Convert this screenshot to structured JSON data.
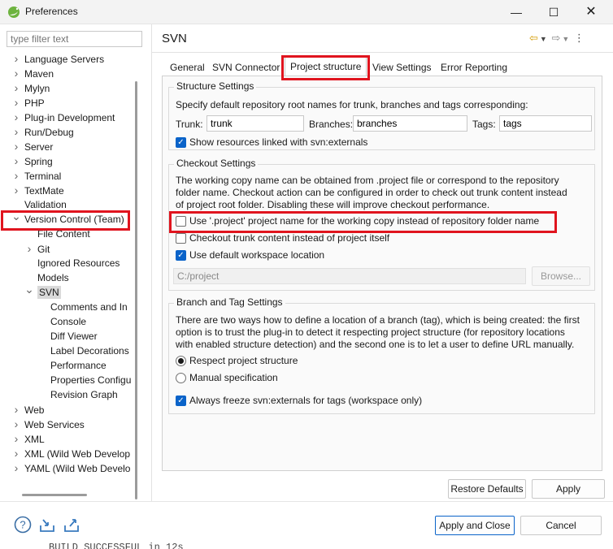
{
  "window": {
    "title": "Preferences",
    "minimize_icon": "minimize-icon",
    "maximize_icon": "maximize-icon",
    "close_icon": "close-icon"
  },
  "sidebar": {
    "filter_placeholder": "type filter text",
    "tree": [
      {
        "label": "Language Servers",
        "level": 0,
        "twisty": "collapsed"
      },
      {
        "label": "Maven",
        "level": 0,
        "twisty": "collapsed"
      },
      {
        "label": "Mylyn",
        "level": 0,
        "twisty": "collapsed"
      },
      {
        "label": "PHP",
        "level": 0,
        "twisty": "collapsed"
      },
      {
        "label": "Plug-in Development",
        "level": 0,
        "twisty": "collapsed"
      },
      {
        "label": "Run/Debug",
        "level": 0,
        "twisty": "collapsed"
      },
      {
        "label": "Server",
        "level": 0,
        "twisty": "collapsed"
      },
      {
        "label": "Spring",
        "level": 0,
        "twisty": "collapsed"
      },
      {
        "label": "Terminal",
        "level": 0,
        "twisty": "collapsed"
      },
      {
        "label": "TextMate",
        "level": 0,
        "twisty": "collapsed"
      },
      {
        "label": "Validation",
        "level": 0,
        "twisty": "none"
      },
      {
        "label": "Version Control (Team)",
        "level": 0,
        "twisty": "expanded"
      },
      {
        "label": "File Content",
        "level": 1,
        "twisty": "none"
      },
      {
        "label": "Git",
        "level": 1,
        "twisty": "collapsed"
      },
      {
        "label": "Ignored Resources",
        "level": 1,
        "twisty": "none"
      },
      {
        "label": "Models",
        "level": 1,
        "twisty": "none"
      },
      {
        "label": "SVN",
        "level": 1,
        "twisty": "expanded",
        "selected": true
      },
      {
        "label": "Comments and In",
        "level": 2,
        "twisty": "none"
      },
      {
        "label": "Console",
        "level": 2,
        "twisty": "none"
      },
      {
        "label": "Diff Viewer",
        "level": 2,
        "twisty": "none"
      },
      {
        "label": "Label Decorations",
        "level": 2,
        "twisty": "none"
      },
      {
        "label": "Performance",
        "level": 2,
        "twisty": "none"
      },
      {
        "label": "Properties Configu",
        "level": 2,
        "twisty": "none"
      },
      {
        "label": "Revision Graph",
        "level": 2,
        "twisty": "none"
      },
      {
        "label": "Web",
        "level": 0,
        "twisty": "collapsed"
      },
      {
        "label": "Web Services",
        "level": 0,
        "twisty": "collapsed"
      },
      {
        "label": "XML",
        "level": 0,
        "twisty": "collapsed"
      },
      {
        "label": "XML (Wild Web Develop",
        "level": 0,
        "twisty": "collapsed"
      },
      {
        "label": "YAML (Wild Web Develo",
        "level": 0,
        "twisty": "collapsed"
      }
    ]
  },
  "panel": {
    "title": "SVN",
    "nav_icons": [
      "back-arrow-icon",
      "dropdown-icon",
      "forward-arrow-icon",
      "dropdown-icon",
      "more-icon"
    ],
    "tabs": [
      "General",
      "SVN Connector",
      "Project structure",
      "View Settings",
      "Error Reporting"
    ],
    "active_tab": "Project structure",
    "structure": {
      "title": "Structure Settings",
      "desc": "Specify default repository root names for trunk, branches and tags corresponding:",
      "trunk_label": "Trunk:",
      "trunk_value": "trunk",
      "branches_label": "Branches:",
      "branches_value": "branches",
      "tags_label": "Tags:",
      "tags_value": "tags",
      "externals_label": "Show resources linked with svn:externals",
      "externals_checked": true
    },
    "checkout": {
      "title": "Checkout Settings",
      "desc": [
        "The working copy name can be obtained from .project file or correspond to the repository",
        "folder name. Checkout action can be configured in order to check out trunk content instead",
        "of project root folder. Disabling these will improve checkout performance."
      ],
      "use_project_label": "Use '.project' project name for the working copy instead of repository folder name",
      "use_project_checked": false,
      "trunk_content_label": "Checkout trunk content instead of project itself",
      "trunk_content_checked": false,
      "default_ws_label": "Use default workspace location",
      "default_ws_checked": true,
      "location_value": "C:/project",
      "browse_label": "Browse..."
    },
    "branch_tag": {
      "title": "Branch and Tag Settings",
      "desc": [
        "There are two ways how to define a location of a branch (tag), which is being created: the first",
        "option is to trust the plug-in to detect it respecting project structure (for repository locations",
        "with enabled structure detection) and the second one is to let a user to define URL manually."
      ],
      "respect_label": "Respect project structure",
      "respect_selected": true,
      "manual_label": "Manual specification",
      "manual_selected": false,
      "freeze_label": "Always freeze svn:externals for tags (workspace only)",
      "freeze_checked": true
    },
    "restore_defaults_label": "Restore Defaults",
    "apply_label": "Apply"
  },
  "footer": {
    "icons": [
      "help-icon",
      "import-icon",
      "export-icon"
    ],
    "apply_close_label": "Apply and Close",
    "cancel_label": "Cancel"
  },
  "background_text": "BUILD SUCCESSFUL in 12s",
  "colors": {
    "highlight": "#e0141e",
    "accent": "#0a63c9",
    "selection": "#d9d9d9"
  }
}
